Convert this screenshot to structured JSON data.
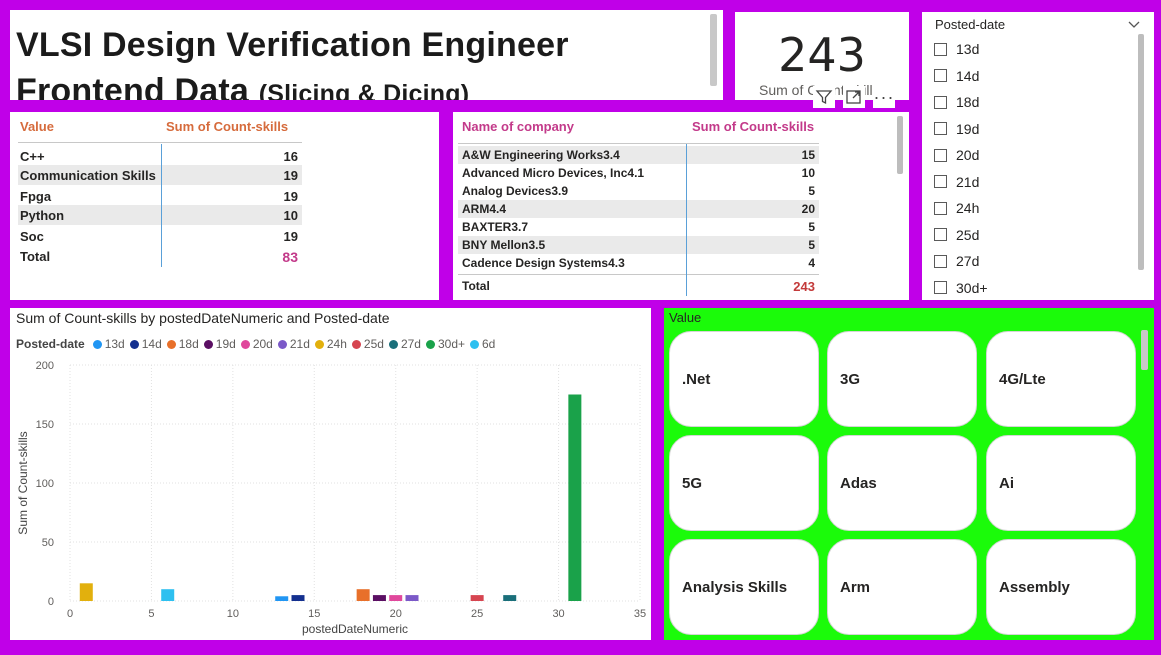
{
  "title": {
    "main": "VLSI Design Verification Engineer Frontend Data",
    "sub": "(Slicing & Dicing)"
  },
  "kpi": {
    "value": "243",
    "label": "Sum of Count-skills"
  },
  "slicer": {
    "title": "Posted-date",
    "items": [
      "13d",
      "14d",
      "18d",
      "19d",
      "20d",
      "21d",
      "24h",
      "25d",
      "27d",
      "30d+"
    ]
  },
  "skills_table": {
    "col1": "Value",
    "col2": "Sum of Count-skills",
    "rows": [
      {
        "name": "C++",
        "value": "16"
      },
      {
        "name": "Communication Skills",
        "value": "19"
      },
      {
        "name": "Fpga",
        "value": "19"
      },
      {
        "name": "Python",
        "value": "10"
      },
      {
        "name": "Soc",
        "value": "19"
      }
    ],
    "total_label": "Total",
    "total_value": "83"
  },
  "company_table": {
    "col1": "Name of company",
    "col2": "Sum of Count-skills",
    "rows": [
      {
        "name": "A&W Engineering Works3.4",
        "value": "15"
      },
      {
        "name": "Advanced Micro Devices, Inc4.1",
        "value": "10"
      },
      {
        "name": "Analog Devices3.9",
        "value": "5"
      },
      {
        "name": "ARM4.4",
        "value": "20"
      },
      {
        "name": "BAXTER3.7",
        "value": "5"
      },
      {
        "name": "BNY Mellon3.5",
        "value": "5"
      },
      {
        "name": "Cadence Design Systems4.3",
        "value": "4"
      }
    ],
    "total_label": "Total",
    "total_value": "243"
  },
  "chart_data": {
    "type": "bar",
    "title": "Sum of Count-skills by postedDateNumeric and Posted-date",
    "xlabel": "postedDateNumeric",
    "ylabel": "Sum of Count-skills",
    "xlim": [
      0,
      35
    ],
    "ylim": [
      0,
      200
    ],
    "x_ticks": [
      "0",
      "5",
      "10",
      "15",
      "20",
      "25",
      "30",
      "35"
    ],
    "y_ticks": [
      "0",
      "50",
      "100",
      "150",
      "200"
    ],
    "legend_title": "Posted-date",
    "legend_position": "top-left",
    "grid": true,
    "series": [
      {
        "name": "13d",
        "color": "#2196f3",
        "x": 13,
        "value": 4
      },
      {
        "name": "14d",
        "color": "#14308f",
        "x": 14,
        "value": 5
      },
      {
        "name": "18d",
        "color": "#e8702a",
        "x": 18,
        "value": 10
      },
      {
        "name": "19d",
        "color": "#5b0f63",
        "x": 19,
        "value": 5
      },
      {
        "name": "20d",
        "color": "#e0489c",
        "x": 20,
        "value": 5
      },
      {
        "name": "21d",
        "color": "#7b59c8",
        "x": 21,
        "value": 5
      },
      {
        "name": "24h",
        "color": "#e2b00d",
        "x": 1,
        "value": 15
      },
      {
        "name": "25d",
        "color": "#d64550",
        "x": 25,
        "value": 5
      },
      {
        "name": "27d",
        "color": "#1a6f7a",
        "x": 27,
        "value": 5
      },
      {
        "name": "30d+",
        "color": "#1aa24a",
        "x": 31,
        "value": 175
      },
      {
        "name": "6d",
        "color": "#2ec0f0",
        "x": 6,
        "value": 10
      }
    ]
  },
  "buttons": {
    "title": "Value",
    "items": [
      ".Net",
      "3G",
      "4G/Lte",
      "5G",
      "Adas",
      "Ai",
      "Analysis Skills",
      "Arm",
      "Assembly"
    ]
  }
}
